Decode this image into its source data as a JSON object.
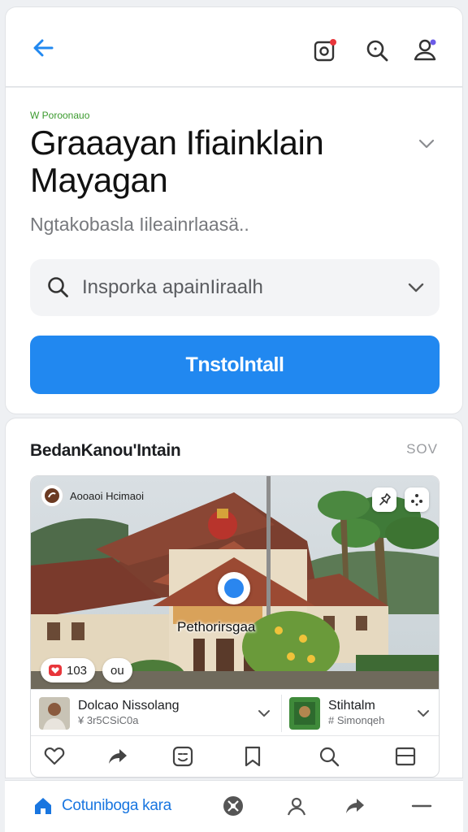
{
  "header": {
    "back_icon": "arrow-left-icon",
    "icons": [
      "camera-notification-icon",
      "search-icon",
      "profile-icon"
    ],
    "accent": "#2188f0"
  },
  "hero": {
    "eyebrow": "W Poroonauo",
    "title": "Graaayan Ifiainklain Mayagan",
    "subtitle": "Ngtakobasla Iileainrlaasä..",
    "search_placeholder": "Insporka apainIiraalh",
    "install_label": "Tnstolntall"
  },
  "section": {
    "title": "BedanKanou'Intain",
    "see_all": "SOV"
  },
  "post": {
    "author": "Aooaoi Hcimaoi",
    "place_label": "Pethorirsgaa",
    "likes": "103",
    "comments": "ou",
    "people": [
      {
        "name": "Dolcao Nissolang",
        "sub": "¥ 3r5CSiC0a"
      },
      {
        "name": "Stihtalm",
        "sub": "# Simonqeh"
      }
    ],
    "actions": [
      "heart-icon",
      "share-icon",
      "sticker-icon",
      "bookmark-icon",
      "search-icon",
      "layout-icon"
    ]
  },
  "bottom_nav": {
    "home_label": "Cotuniboga kara",
    "icons": [
      "home-icon",
      "explore-icon",
      "profile-icon",
      "share-icon",
      "menu-icon"
    ]
  }
}
